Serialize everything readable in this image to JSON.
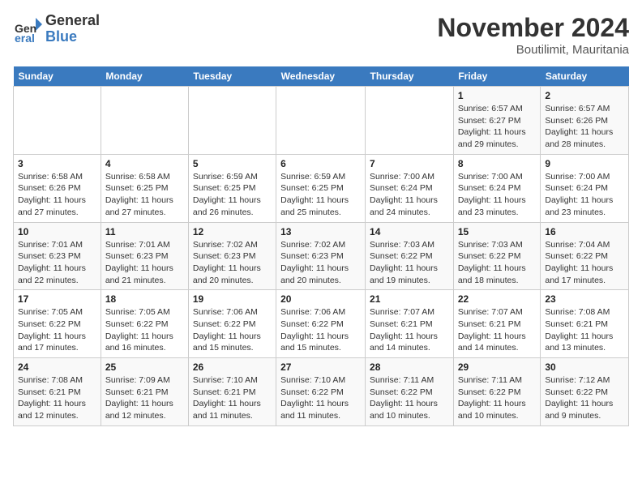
{
  "logo": {
    "line1": "General",
    "line2": "Blue"
  },
  "title": "November 2024",
  "location": "Boutilimit, Mauritania",
  "weekdays": [
    "Sunday",
    "Monday",
    "Tuesday",
    "Wednesday",
    "Thursday",
    "Friday",
    "Saturday"
  ],
  "weeks": [
    [
      {
        "day": "",
        "info": ""
      },
      {
        "day": "",
        "info": ""
      },
      {
        "day": "",
        "info": ""
      },
      {
        "day": "",
        "info": ""
      },
      {
        "day": "",
        "info": ""
      },
      {
        "day": "1",
        "info": "Sunrise: 6:57 AM\nSunset: 6:27 PM\nDaylight: 11 hours and 29 minutes."
      },
      {
        "day": "2",
        "info": "Sunrise: 6:57 AM\nSunset: 6:26 PM\nDaylight: 11 hours and 28 minutes."
      }
    ],
    [
      {
        "day": "3",
        "info": "Sunrise: 6:58 AM\nSunset: 6:26 PM\nDaylight: 11 hours and 27 minutes."
      },
      {
        "day": "4",
        "info": "Sunrise: 6:58 AM\nSunset: 6:25 PM\nDaylight: 11 hours and 27 minutes."
      },
      {
        "day": "5",
        "info": "Sunrise: 6:59 AM\nSunset: 6:25 PM\nDaylight: 11 hours and 26 minutes."
      },
      {
        "day": "6",
        "info": "Sunrise: 6:59 AM\nSunset: 6:25 PM\nDaylight: 11 hours and 25 minutes."
      },
      {
        "day": "7",
        "info": "Sunrise: 7:00 AM\nSunset: 6:24 PM\nDaylight: 11 hours and 24 minutes."
      },
      {
        "day": "8",
        "info": "Sunrise: 7:00 AM\nSunset: 6:24 PM\nDaylight: 11 hours and 23 minutes."
      },
      {
        "day": "9",
        "info": "Sunrise: 7:00 AM\nSunset: 6:24 PM\nDaylight: 11 hours and 23 minutes."
      }
    ],
    [
      {
        "day": "10",
        "info": "Sunrise: 7:01 AM\nSunset: 6:23 PM\nDaylight: 11 hours and 22 minutes."
      },
      {
        "day": "11",
        "info": "Sunrise: 7:01 AM\nSunset: 6:23 PM\nDaylight: 11 hours and 21 minutes."
      },
      {
        "day": "12",
        "info": "Sunrise: 7:02 AM\nSunset: 6:23 PM\nDaylight: 11 hours and 20 minutes."
      },
      {
        "day": "13",
        "info": "Sunrise: 7:02 AM\nSunset: 6:23 PM\nDaylight: 11 hours and 20 minutes."
      },
      {
        "day": "14",
        "info": "Sunrise: 7:03 AM\nSunset: 6:22 PM\nDaylight: 11 hours and 19 minutes."
      },
      {
        "day": "15",
        "info": "Sunrise: 7:03 AM\nSunset: 6:22 PM\nDaylight: 11 hours and 18 minutes."
      },
      {
        "day": "16",
        "info": "Sunrise: 7:04 AM\nSunset: 6:22 PM\nDaylight: 11 hours and 17 minutes."
      }
    ],
    [
      {
        "day": "17",
        "info": "Sunrise: 7:05 AM\nSunset: 6:22 PM\nDaylight: 11 hours and 17 minutes."
      },
      {
        "day": "18",
        "info": "Sunrise: 7:05 AM\nSunset: 6:22 PM\nDaylight: 11 hours and 16 minutes."
      },
      {
        "day": "19",
        "info": "Sunrise: 7:06 AM\nSunset: 6:22 PM\nDaylight: 11 hours and 15 minutes."
      },
      {
        "day": "20",
        "info": "Sunrise: 7:06 AM\nSunset: 6:22 PM\nDaylight: 11 hours and 15 minutes."
      },
      {
        "day": "21",
        "info": "Sunrise: 7:07 AM\nSunset: 6:21 PM\nDaylight: 11 hours and 14 minutes."
      },
      {
        "day": "22",
        "info": "Sunrise: 7:07 AM\nSunset: 6:21 PM\nDaylight: 11 hours and 14 minutes."
      },
      {
        "day": "23",
        "info": "Sunrise: 7:08 AM\nSunset: 6:21 PM\nDaylight: 11 hours and 13 minutes."
      }
    ],
    [
      {
        "day": "24",
        "info": "Sunrise: 7:08 AM\nSunset: 6:21 PM\nDaylight: 11 hours and 12 minutes."
      },
      {
        "day": "25",
        "info": "Sunrise: 7:09 AM\nSunset: 6:21 PM\nDaylight: 11 hours and 12 minutes."
      },
      {
        "day": "26",
        "info": "Sunrise: 7:10 AM\nSunset: 6:21 PM\nDaylight: 11 hours and 11 minutes."
      },
      {
        "day": "27",
        "info": "Sunrise: 7:10 AM\nSunset: 6:22 PM\nDaylight: 11 hours and 11 minutes."
      },
      {
        "day": "28",
        "info": "Sunrise: 7:11 AM\nSunset: 6:22 PM\nDaylight: 11 hours and 10 minutes."
      },
      {
        "day": "29",
        "info": "Sunrise: 7:11 AM\nSunset: 6:22 PM\nDaylight: 11 hours and 10 minutes."
      },
      {
        "day": "30",
        "info": "Sunrise: 7:12 AM\nSunset: 6:22 PM\nDaylight: 11 hours and 9 minutes."
      }
    ]
  ]
}
